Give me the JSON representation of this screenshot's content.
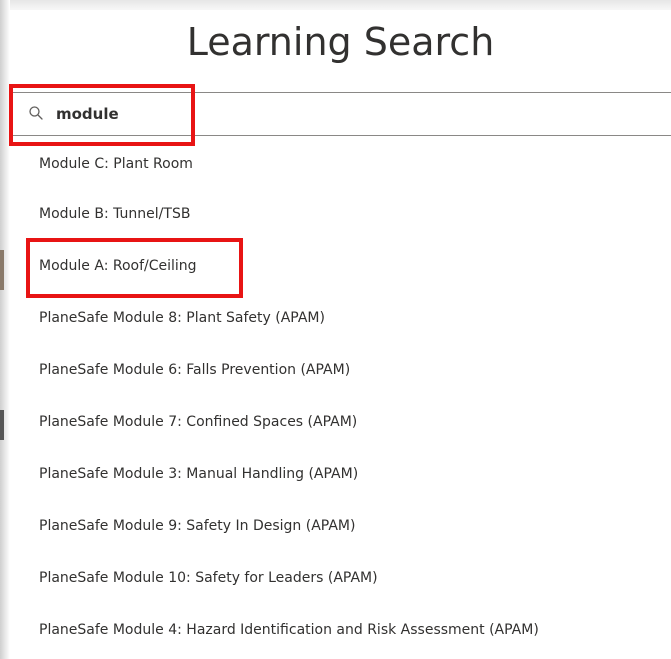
{
  "page": {
    "title": "Learning Search"
  },
  "search": {
    "value": "module",
    "icon": "search-icon"
  },
  "results": [
    {
      "label": "Module C: Plant Room"
    },
    {
      "label": "Module B: Tunnel/TSB"
    },
    {
      "label": "Module A: Roof/Ceiling"
    },
    {
      "label": "PlaneSafe Module 8: Plant Safety (APAM)"
    },
    {
      "label": "PlaneSafe Module 6: Falls Prevention (APAM)"
    },
    {
      "label": "PlaneSafe Module 7: Confined Spaces (APAM)"
    },
    {
      "label": "PlaneSafe Module 3: Manual Handling (APAM)"
    },
    {
      "label": "PlaneSafe Module 9: Safety In Design (APAM)"
    },
    {
      "label": "PlaneSafe Module 10: Safety for Leaders (APAM)"
    },
    {
      "label": "PlaneSafe Module 4: Hazard Identification and Risk Assessment (APAM)"
    }
  ],
  "colors": {
    "highlight": "#e81414",
    "text": "#323130"
  }
}
